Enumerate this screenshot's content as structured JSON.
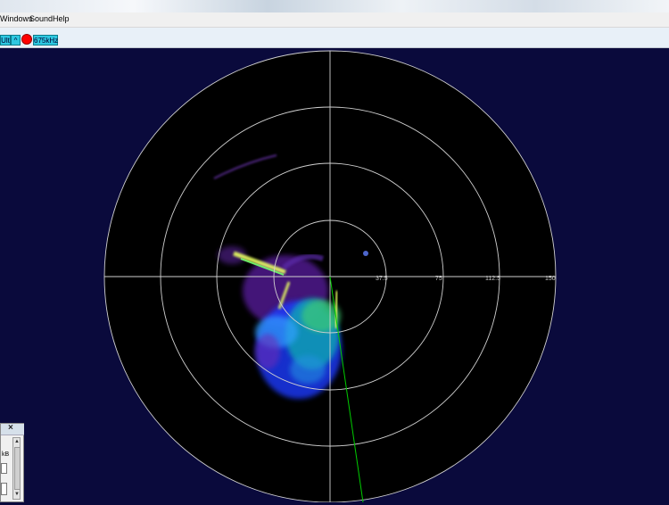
{
  "menu": {
    "items": [
      "Windows",
      "Sound",
      "Help"
    ]
  },
  "toolbar": {
    "mode_label": "Ult",
    "frequency_label": "675kHz",
    "record_color": "#ff0000"
  },
  "sonar": {
    "range_labels": [
      "37.5",
      "75",
      "112.5",
      "150"
    ],
    "background_color": "#000000",
    "grid_color": "#d0d0d0",
    "heading_line_color": "#00cc00"
  },
  "side_panel": {
    "close_label": "×",
    "unit_label": "kB"
  }
}
